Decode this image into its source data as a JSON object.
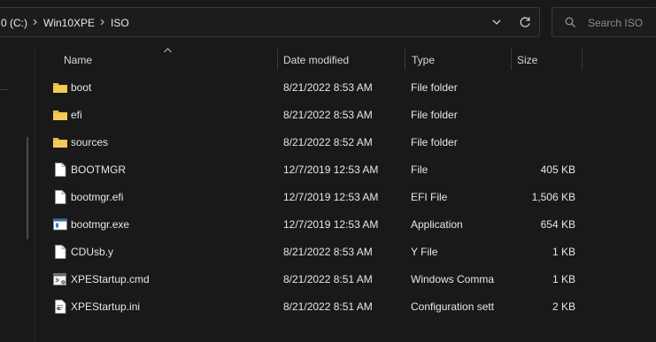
{
  "address_bar": {
    "crumbs": [
      "0 (C:)",
      "Win10XPE",
      "ISO"
    ],
    "refresh_icon": "refresh-icon",
    "dropdown_icon": "chevron-down-icon"
  },
  "search": {
    "placeholder": "Search ISO",
    "icon": "search-icon"
  },
  "columns": {
    "name": "Name",
    "date": "Date modified",
    "type": "Type",
    "size": "Size"
  },
  "files": [
    {
      "name": "boot",
      "date": "8/21/2022 8:53 AM",
      "type": "File folder",
      "size": "",
      "icon": "folder-icon"
    },
    {
      "name": "efi",
      "date": "8/21/2022 8:53 AM",
      "type": "File folder",
      "size": "",
      "icon": "folder-icon"
    },
    {
      "name": "sources",
      "date": "8/21/2022 8:52 AM",
      "type": "File folder",
      "size": "",
      "icon": "folder-icon"
    },
    {
      "name": "BOOTMGR",
      "date": "12/7/2019 12:53 AM",
      "type": "File",
      "size": "405 KB",
      "icon": "file-icon"
    },
    {
      "name": "bootmgr.efi",
      "date": "12/7/2019 12:53 AM",
      "type": "EFI File",
      "size": "1,506 KB",
      "icon": "file-icon"
    },
    {
      "name": "bootmgr.exe",
      "date": "12/7/2019 12:53 AM",
      "type": "Application",
      "size": "654 KB",
      "icon": "application-icon"
    },
    {
      "name": "CDUsb.y",
      "date": "8/21/2022 8:53 AM",
      "type": "Y File",
      "size": "1 KB",
      "icon": "file-icon"
    },
    {
      "name": "XPEStartup.cmd",
      "date": "8/21/2022 8:51 AM",
      "type": "Windows Comma",
      "size": "1 KB",
      "icon": "cmd-script-icon"
    },
    {
      "name": "XPEStartup.ini",
      "date": "8/21/2022 8:51 AM",
      "type": "Configuration sett",
      "size": "2 KB",
      "icon": "settings-file-icon"
    }
  ],
  "colors": {
    "background": "#191919",
    "folder": "#e8b84a",
    "text": "#e6e6e6"
  }
}
